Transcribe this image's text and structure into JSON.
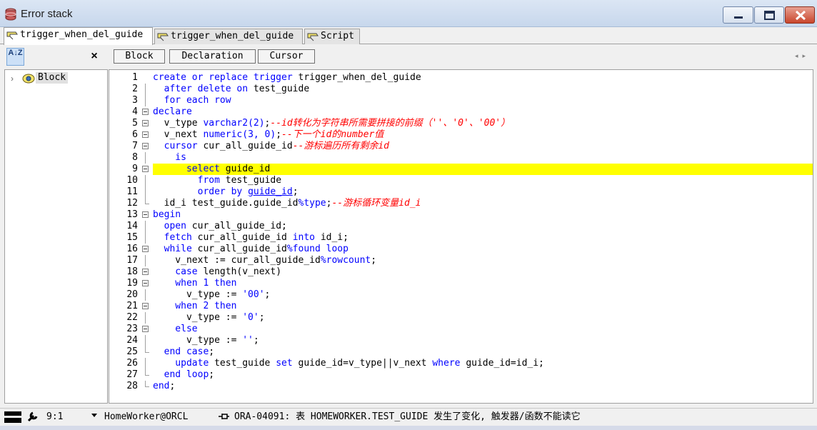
{
  "window": {
    "title": "Error stack",
    "buttons": {
      "minimize": "minimize",
      "maximize": "maximize",
      "close": "close"
    }
  },
  "tabs": [
    {
      "label": "trigger_when_del_guide",
      "active": true,
      "icon": "trigger-icon"
    },
    {
      "label": "trigger_when_del_guide",
      "active": false,
      "icon": "trigger-icon"
    },
    {
      "label": "Script",
      "active": false,
      "icon": "script-icon"
    }
  ],
  "left_panel": {
    "sort_label": "A↓Z",
    "close_label": "×",
    "tree": [
      {
        "label": "Block",
        "icon": "block-icon",
        "chevron": "›"
      }
    ]
  },
  "toolbar": {
    "buttons": [
      "Block",
      "Declaration",
      "Cursor"
    ],
    "scroll_arrows": "◂▸"
  },
  "editor": {
    "highlight_line": 9,
    "highlight_color": "#ffff00",
    "lines": [
      {
        "n": "1",
        "fold": "start",
        "tokens": [
          [
            "k",
            "create or replace trigger "
          ],
          [
            "t",
            "trigger_when_del_guide"
          ]
        ]
      },
      {
        "n": "2",
        "fold": "line",
        "tokens": [
          [
            "k",
            "  after delete on "
          ],
          [
            "t",
            "test_guide"
          ]
        ]
      },
      {
        "n": "3",
        "fold": "line",
        "tokens": [
          [
            "k",
            "  for each row"
          ]
        ]
      },
      {
        "n": "4",
        "fold": "box",
        "tokens": [
          [
            "k",
            "declare"
          ]
        ]
      },
      {
        "n": "5",
        "fold": "box",
        "tokens": [
          [
            "t",
            "  v_type "
          ],
          [
            "k",
            "varchar2(2)"
          ],
          [
            "t",
            ";"
          ],
          [
            "c",
            "--id转化为字符串所需要拼接的前缀（''、'0'、'00'）"
          ]
        ]
      },
      {
        "n": "6",
        "fold": "box",
        "tokens": [
          [
            "t",
            "  v_next "
          ],
          [
            "k",
            "numeric(3, 0)"
          ],
          [
            "t",
            ";"
          ],
          [
            "c",
            "--下一个id的number值"
          ]
        ]
      },
      {
        "n": "7",
        "fold": "box",
        "tokens": [
          [
            "k",
            "  cursor "
          ],
          [
            "t",
            "cur_all_guide_id"
          ],
          [
            "c",
            "--游标遍历所有剩余id"
          ]
        ]
      },
      {
        "n": "8",
        "fold": "line",
        "tokens": [
          [
            "k",
            "    is"
          ]
        ]
      },
      {
        "n": "9",
        "fold": "box",
        "tokens": [
          [
            "k",
            "      select "
          ],
          [
            "t",
            "guide_id"
          ]
        ]
      },
      {
        "n": "10",
        "fold": "line",
        "tokens": [
          [
            "k",
            "        from "
          ],
          [
            "t",
            "test_guide"
          ]
        ]
      },
      {
        "n": "11",
        "fold": "line",
        "tokens": [
          [
            "k",
            "        order by "
          ],
          [
            "u",
            "guide_id"
          ],
          [
            "t",
            ";"
          ]
        ]
      },
      {
        "n": "12",
        "fold": "end",
        "tokens": [
          [
            "t",
            "  id_i test_guide.guide_id"
          ],
          [
            "k",
            "%type"
          ],
          [
            "t",
            ";"
          ],
          [
            "c",
            "--游标循环变量id_i"
          ]
        ]
      },
      {
        "n": "13",
        "fold": "box",
        "tokens": [
          [
            "k",
            "begin"
          ]
        ]
      },
      {
        "n": "14",
        "fold": "line",
        "tokens": [
          [
            "k",
            "  open "
          ],
          [
            "t",
            "cur_all_guide_id;"
          ]
        ]
      },
      {
        "n": "15",
        "fold": "line",
        "tokens": [
          [
            "k",
            "  fetch "
          ],
          [
            "t",
            "cur_all_guide_id "
          ],
          [
            "k",
            "into "
          ],
          [
            "t",
            "id_i;"
          ]
        ]
      },
      {
        "n": "16",
        "fold": "box",
        "tokens": [
          [
            "k",
            "  while "
          ],
          [
            "t",
            "cur_all_guide_id"
          ],
          [
            "k",
            "%found loop"
          ]
        ]
      },
      {
        "n": "17",
        "fold": "line",
        "tokens": [
          [
            "t",
            "    v_next := cur_all_guide_id"
          ],
          [
            "k",
            "%rowcount"
          ],
          [
            "t",
            ";"
          ]
        ]
      },
      {
        "n": "18",
        "fold": "box",
        "tokens": [
          [
            "k",
            "    case "
          ],
          [
            "t",
            "length(v_next)"
          ]
        ]
      },
      {
        "n": "19",
        "fold": "box",
        "tokens": [
          [
            "k",
            "    when "
          ],
          [
            "s",
            "1 "
          ],
          [
            "k",
            "then"
          ]
        ]
      },
      {
        "n": "20",
        "fold": "line",
        "tokens": [
          [
            "t",
            "      v_type := "
          ],
          [
            "s",
            "'00'"
          ],
          [
            "t",
            ";"
          ]
        ]
      },
      {
        "n": "21",
        "fold": "box",
        "tokens": [
          [
            "k",
            "    when "
          ],
          [
            "s",
            "2 "
          ],
          [
            "k",
            "then"
          ]
        ]
      },
      {
        "n": "22",
        "fold": "line",
        "tokens": [
          [
            "t",
            "      v_type := "
          ],
          [
            "s",
            "'0'"
          ],
          [
            "t",
            ";"
          ]
        ]
      },
      {
        "n": "23",
        "fold": "box",
        "tokens": [
          [
            "k",
            "    else"
          ]
        ]
      },
      {
        "n": "24",
        "fold": "line",
        "tokens": [
          [
            "t",
            "      v_type := "
          ],
          [
            "s",
            "''"
          ],
          [
            "t",
            ";"
          ]
        ]
      },
      {
        "n": "25",
        "fold": "end",
        "tokens": [
          [
            "k",
            "  end case"
          ],
          [
            "t",
            ";"
          ]
        ]
      },
      {
        "n": "26",
        "fold": "line",
        "tokens": [
          [
            "k",
            "    update "
          ],
          [
            "t",
            "test_guide "
          ],
          [
            "k",
            "set "
          ],
          [
            "t",
            "guide_id=v_type||v_next "
          ],
          [
            "k",
            "where "
          ],
          [
            "t",
            "guide_id=id_i;"
          ]
        ]
      },
      {
        "n": "27",
        "fold": "end",
        "tokens": [
          [
            "k",
            "  end loop"
          ],
          [
            "t",
            ";"
          ]
        ]
      },
      {
        "n": "28",
        "fold": "end",
        "tokens": [
          [
            "k",
            "end"
          ],
          [
            "t",
            ";"
          ]
        ]
      }
    ]
  },
  "status": {
    "position": "9:1",
    "connection": "HomeWorker@ORCL",
    "message": "ORA-04091: 表 HOMEWORKER.TEST_GUIDE 发生了变化, 触发器/函数不能读它"
  }
}
